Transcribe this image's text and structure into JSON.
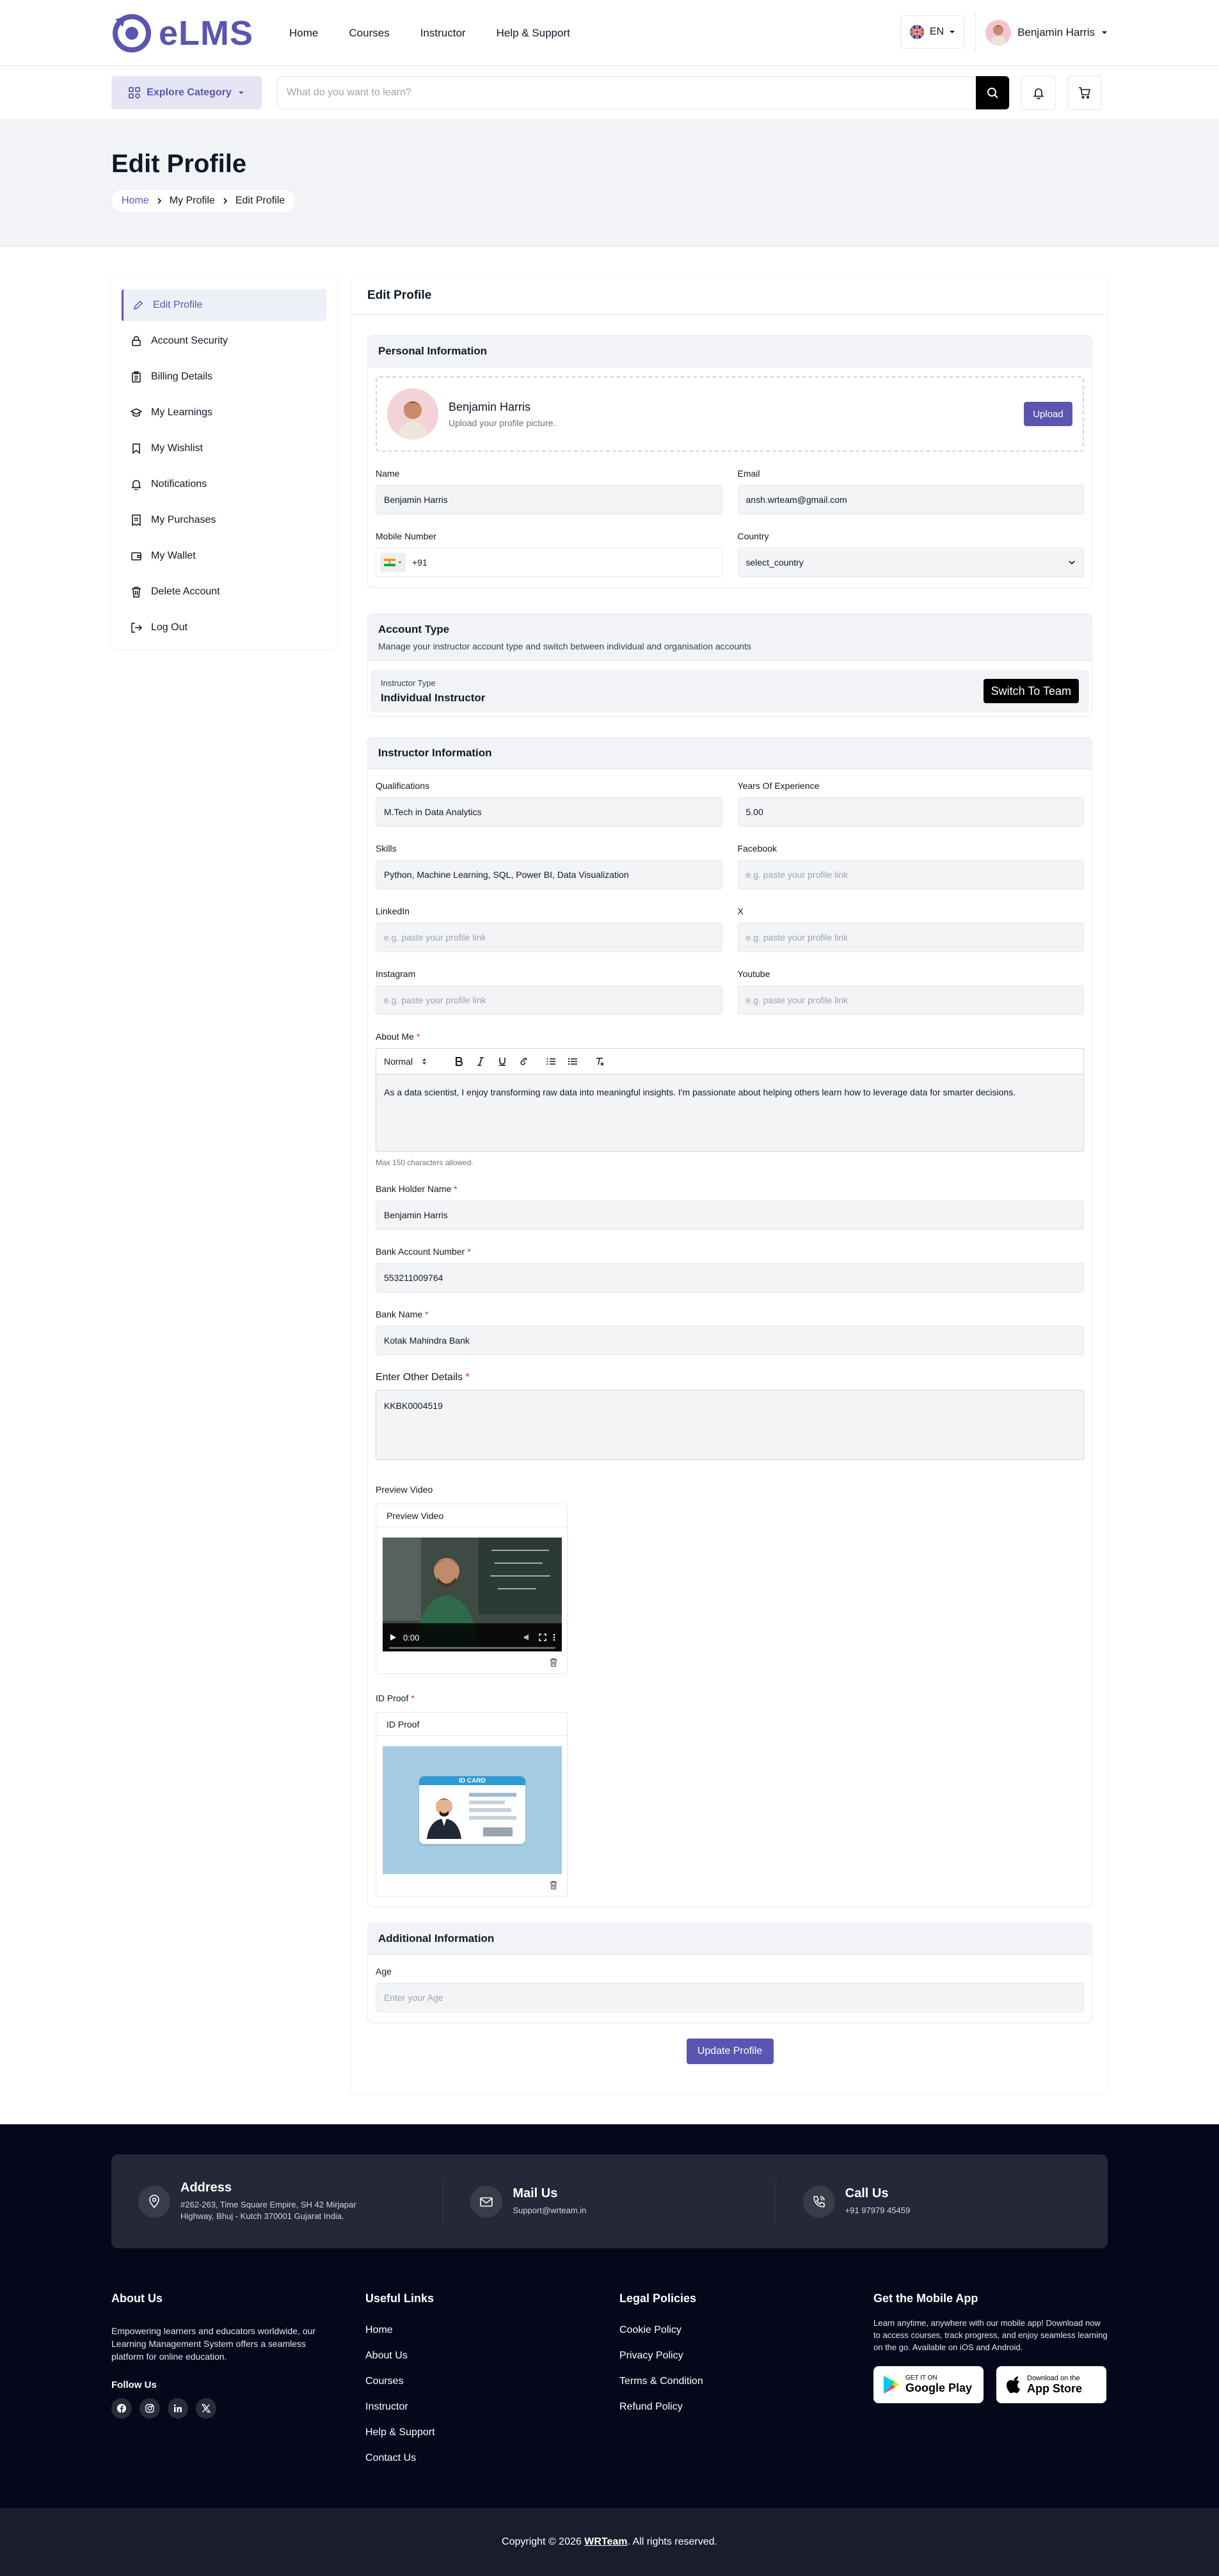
{
  "brand": {
    "name": "eLMS",
    "accent": "#5a55b0"
  },
  "nav": {
    "items": [
      "Home",
      "Courses",
      "Instructor",
      "Help & Support"
    ]
  },
  "header": {
    "language": "EN",
    "user_name": "Benjamin Harris"
  },
  "search": {
    "explore_label": "Explore Category",
    "placeholder": "What do you want to learn?"
  },
  "page": {
    "title": "Edit Profile",
    "breadcrumb": [
      "Home",
      "My Profile",
      "Edit Profile"
    ]
  },
  "sidebar": {
    "items": [
      {
        "label": "Edit Profile",
        "icon": "edit-icon",
        "active": true
      },
      {
        "label": "Account Security",
        "icon": "lock-icon"
      },
      {
        "label": "Billing Details",
        "icon": "clipboard-icon"
      },
      {
        "label": "My Learnings",
        "icon": "graduation-cap-icon"
      },
      {
        "label": "My Wishlist",
        "icon": "bookmark-icon"
      },
      {
        "label": "Notifications",
        "icon": "bell-icon"
      },
      {
        "label": "My Purchases",
        "icon": "receipt-icon"
      },
      {
        "label": "My Wallet",
        "icon": "wallet-icon"
      },
      {
        "label": "Delete Account",
        "icon": "trash-icon"
      },
      {
        "label": "Log Out",
        "icon": "logout-icon"
      }
    ]
  },
  "form": {
    "panel_title": "Edit Profile",
    "personal": {
      "title": "Personal Information",
      "name_display": "Benjamin Harris",
      "upload_hint": "Upload your profile picture.",
      "upload_label": "Upload",
      "name_label": "Name",
      "name_value": "Benjamin Harris",
      "email_label": "Email",
      "email_value": "ansh.wrteam@gmail.com",
      "mobile_label": "Mobile Number",
      "mobile_code": "+91",
      "country_label": "Country",
      "country_value": "select_country"
    },
    "account": {
      "title": "Account Type",
      "subtitle": "Manage your instructor account type and switch between individual and organisation accounts",
      "type_label": "Instructor Type",
      "type_value": "Individual Instructor",
      "switch_label": "Switch To Team"
    },
    "instructor": {
      "title": "Instructor Information",
      "qualifications_label": "Qualifications",
      "qualifications_value": "M.Tech in Data Analytics",
      "experience_label": "Years Of Experience",
      "experience_value": "5.00",
      "skills_label": "Skills",
      "skills_value": "Python, Machine Learning, SQL, Power BI, Data Visualization",
      "facebook_label": "Facebook",
      "linkedin_label": "LinkedIn",
      "x_label": "X",
      "instagram_label": "Instagram",
      "youtube_label": "Youtube",
      "link_placeholder": "e.g. paste your profile link",
      "about_label": "About Me",
      "editor_format": "Normal",
      "about_value": "As a data scientist, I enjoy transforming raw data into meaningful insights. I'm passionate about helping others learn how to leverage data for smarter decisions.",
      "about_hint": "Max 150 characters allowed.",
      "bank_holder_label": "Bank Holder Name",
      "bank_holder_value": "Benjamin Harris",
      "bank_account_label": "Bank Account Number",
      "bank_account_value": "553211009764",
      "bank_name_label": "Bank Name",
      "bank_name_value": "Kotak Mahindra Bank",
      "other_label": "Enter Other Details",
      "other_value": "KKBK0004519",
      "preview_video_label": "Preview Video",
      "preview_video_box": "Preview Video",
      "video_time": "0:00",
      "id_proof_label": "ID Proof",
      "id_proof_box": "ID Proof",
      "id_card_text": "ID CARD"
    },
    "additional": {
      "title": "Additional Information",
      "age_label": "Age",
      "age_placeholder": "Enter your Age"
    },
    "submit_label": "Update Profile"
  },
  "footer": {
    "address_title": "Address",
    "address_line1": "#262-263, Time Square Empire, SH 42 Mirjapar",
    "address_line2": "Highway, Bhuj - Kutch 370001 Gujarat India.",
    "mail_title": "Mail Us",
    "mail_value": "Support@wrteam.in",
    "call_title": "Call Us",
    "call_value": "+91 97979 45459",
    "about_title": "About Us",
    "about_text": "Empowering learners and educators worldwide, our Learning Management System offers a seamless platform for online education.",
    "follow_title": "Follow Us",
    "useful_title": "Useful Links",
    "useful_links": [
      "Home",
      "About Us",
      "Courses",
      "Instructor",
      "Help & Support",
      "Contact Us"
    ],
    "legal_title": "Legal Policies",
    "legal_links": [
      "Cookie Policy",
      "Privacy Policy",
      "Terms & Condition",
      "Refund Policy"
    ],
    "app_title": "Get the Mobile App",
    "app_text": "Learn anytime, anywhere with our mobile app! Download now to access courses, track progress, and enjoy seamless learning on the go. Available on iOS and Android.",
    "gplay_small": "GET IT ON",
    "gplay_big": "Google Play",
    "appstore_small": "Download on the",
    "appstore_big": "App Store",
    "copyright_pre": "Copyright © 2026 ",
    "copyright_brand": "WRTeam",
    "copyright_post": ". All rights reserved."
  }
}
